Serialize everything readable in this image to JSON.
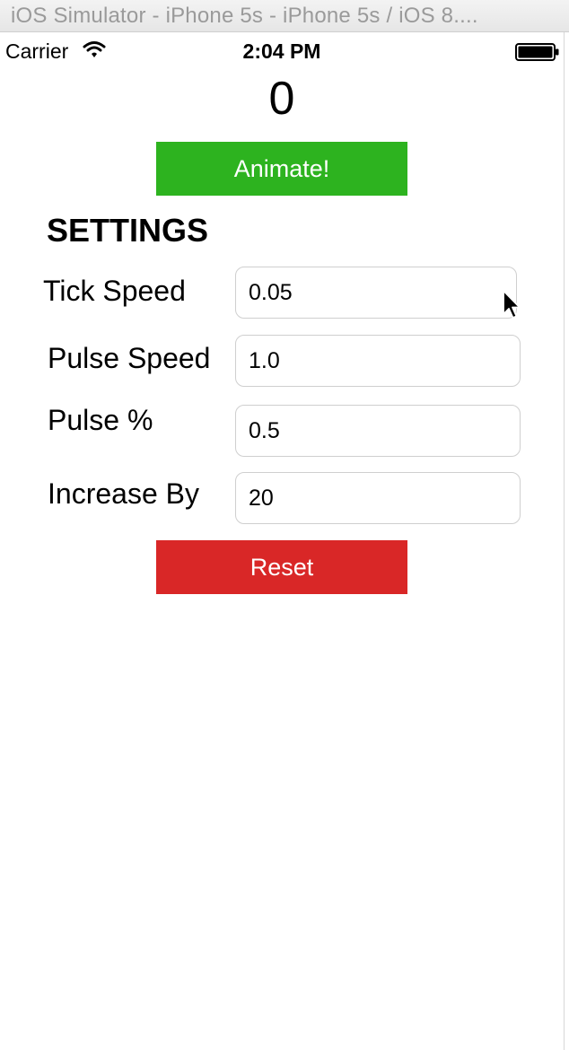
{
  "window": {
    "title": "iOS Simulator - iPhone 5s - iPhone 5s / iOS 8...."
  },
  "status_bar": {
    "carrier": "Carrier",
    "time": "2:04 PM",
    "icons": [
      "wifi-icon",
      "battery-icon"
    ]
  },
  "main": {
    "counter": "0",
    "animate_label": "Animate!",
    "settings_heading": "SETTINGS",
    "settings": [
      {
        "label": "Tick Speed",
        "value": "0.05"
      },
      {
        "label": "Pulse Speed",
        "value": "1.0"
      },
      {
        "label": "Pulse %",
        "value": "0.5"
      },
      {
        "label": "Increase By",
        "value": "20"
      }
    ],
    "reset_label": "Reset"
  },
  "colors": {
    "animate_button": "#2db31f",
    "reset_button": "#d92727",
    "title_text": "#9a9a9a"
  },
  "pointer": "cursor-arrow-icon"
}
